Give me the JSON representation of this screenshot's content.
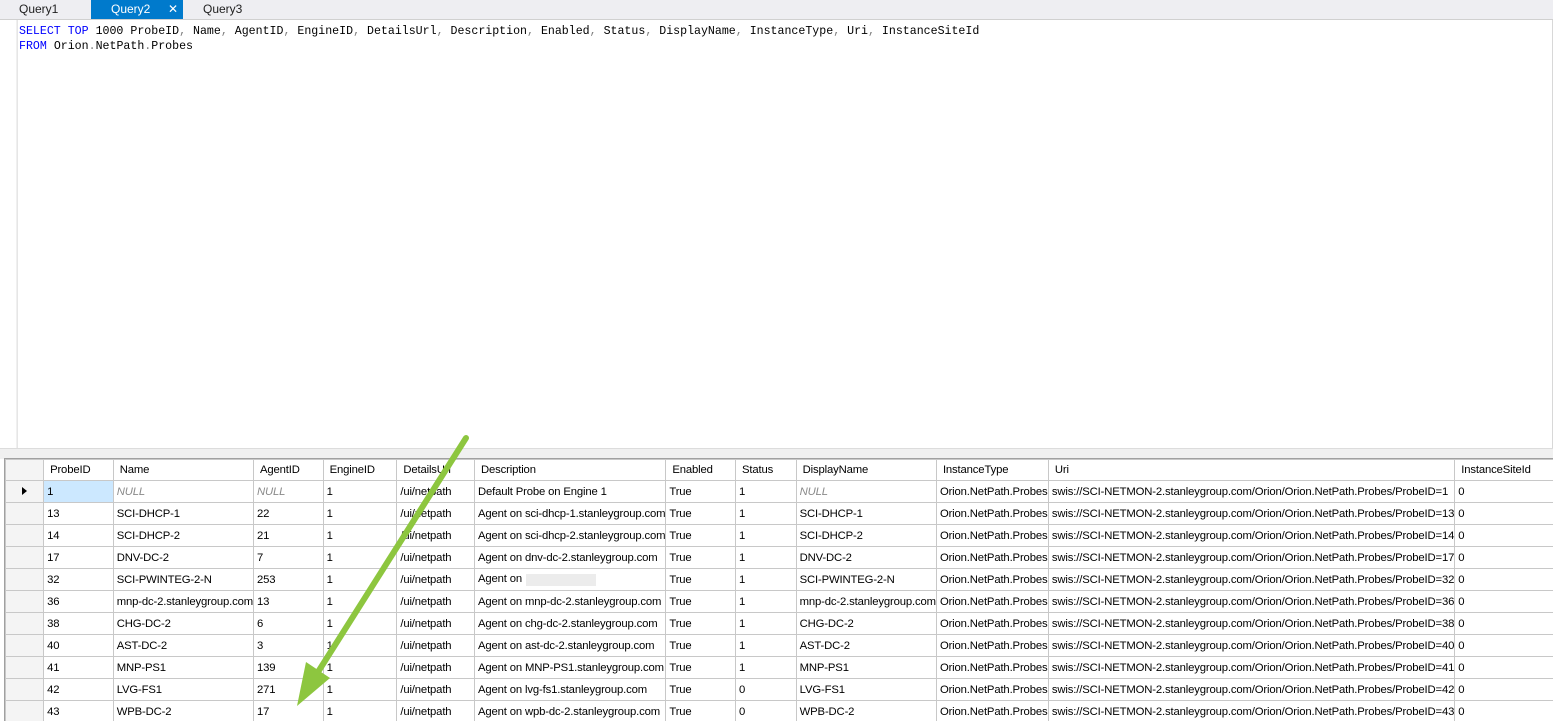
{
  "tabs": [
    {
      "label": "Query1",
      "active": false
    },
    {
      "label": "Query2",
      "active": true,
      "close": "✕"
    },
    {
      "label": "Query3",
      "active": false
    }
  ],
  "editor": {
    "line1": {
      "kw_select": "SELECT",
      "kw_top": "TOP",
      "limit": "1000",
      "columns": [
        {
          "name": "ProbeID",
          "sep": ", "
        },
        {
          "name": "Name",
          "sep": ", "
        },
        {
          "name": "AgentID",
          "sep": ", "
        },
        {
          "name": "EngineID",
          "sep": ", "
        },
        {
          "name": "DetailsUrl",
          "sep": ", "
        },
        {
          "name": "Description",
          "sep": ", "
        },
        {
          "name": "Enabled",
          "sep": ", "
        },
        {
          "name": "Status",
          "sep": ", "
        },
        {
          "name": "DisplayName",
          "sep": ", "
        },
        {
          "name": "InstanceType",
          "sep": ", "
        },
        {
          "name": "Uri",
          "sep": ", "
        },
        {
          "name": "InstanceSiteId",
          "sep": ""
        }
      ]
    },
    "line2": {
      "kw_from": "FROM",
      "tbl1": "Orion",
      "dot1": ".",
      "tbl2": "NetPath",
      "dot2": ".",
      "tbl3": "Probes"
    }
  },
  "grid": {
    "columns": [
      "ProbeID",
      "Name",
      "AgentID",
      "EngineID",
      "DetailsUrl",
      "Description",
      "Enabled",
      "Status",
      "DisplayName",
      "InstanceType",
      "Uri",
      "InstanceSiteId"
    ],
    "rows": [
      [
        "1",
        "NULL",
        "NULL",
        "1",
        "/ui/netpath",
        "Default Probe on Engine 1",
        "True",
        "1",
        "NULL",
        "Orion.NetPath.Probes",
        "swis://SCI-NETMON-2.stanleygroup.com/Orion/Orion.NetPath.Probes/ProbeID=1",
        "0"
      ],
      [
        "13",
        "SCI-DHCP-1",
        "22",
        "1",
        "/ui/netpath",
        "Agent on sci-dhcp-1.stanleygroup.com",
        "True",
        "1",
        "SCI-DHCP-1",
        "Orion.NetPath.Probes",
        "swis://SCI-NETMON-2.stanleygroup.com/Orion/Orion.NetPath.Probes/ProbeID=13",
        "0"
      ],
      [
        "14",
        "SCI-DHCP-2",
        "21",
        "1",
        "/ui/netpath",
        "Agent on sci-dhcp-2.stanleygroup.com",
        "True",
        "1",
        "SCI-DHCP-2",
        "Orion.NetPath.Probes",
        "swis://SCI-NETMON-2.stanleygroup.com/Orion/Orion.NetPath.Probes/ProbeID=14",
        "0"
      ],
      [
        "17",
        "DNV-DC-2",
        "7",
        "1",
        "/ui/netpath",
        "Agent on dnv-dc-2.stanleygroup.com",
        "True",
        "1",
        "DNV-DC-2",
        "Orion.NetPath.Probes",
        "swis://SCI-NETMON-2.stanleygroup.com/Orion/Orion.NetPath.Probes/ProbeID=17",
        "0"
      ],
      [
        "32",
        "SCI-PWINTEG-2-N",
        "253",
        "1",
        "/ui/netpath",
        "Agent on",
        "True",
        "1",
        "SCI-PWINTEG-2-N",
        "Orion.NetPath.Probes",
        "swis://SCI-NETMON-2.stanleygroup.com/Orion/Orion.NetPath.Probes/ProbeID=32",
        "0"
      ],
      [
        "36",
        "mnp-dc-2.stanleygroup.com",
        "13",
        "1",
        "/ui/netpath",
        "Agent on mnp-dc-2.stanleygroup.com",
        "True",
        "1",
        "mnp-dc-2.stanleygroup.com",
        "Orion.NetPath.Probes",
        "swis://SCI-NETMON-2.stanleygroup.com/Orion/Orion.NetPath.Probes/ProbeID=36",
        "0"
      ],
      [
        "38",
        "CHG-DC-2",
        "6",
        "1",
        "/ui/netpath",
        "Agent on chg-dc-2.stanleygroup.com",
        "True",
        "1",
        "CHG-DC-2",
        "Orion.NetPath.Probes",
        "swis://SCI-NETMON-2.stanleygroup.com/Orion/Orion.NetPath.Probes/ProbeID=38",
        "0"
      ],
      [
        "40",
        "AST-DC-2",
        "3",
        "1",
        "/ui/netpath",
        "Agent on ast-dc-2.stanleygroup.com",
        "True",
        "1",
        "AST-DC-2",
        "Orion.NetPath.Probes",
        "swis://SCI-NETMON-2.stanleygroup.com/Orion/Orion.NetPath.Probes/ProbeID=40",
        "0"
      ],
      [
        "41",
        "MNP-PS1",
        "139",
        "1",
        "/ui/netpath",
        "Agent on MNP-PS1.stanleygroup.com",
        "True",
        "1",
        "MNP-PS1",
        "Orion.NetPath.Probes",
        "swis://SCI-NETMON-2.stanleygroup.com/Orion/Orion.NetPath.Probes/ProbeID=41",
        "0"
      ],
      [
        "42",
        "LVG-FS1",
        "271",
        "1",
        "/ui/netpath",
        "Agent on lvg-fs1.stanleygroup.com",
        "True",
        "0",
        "LVG-FS1",
        "Orion.NetPath.Probes",
        "swis://SCI-NETMON-2.stanleygroup.com/Orion/Orion.NetPath.Probes/ProbeID=42",
        "0"
      ],
      [
        "43",
        "WPB-DC-2",
        "17",
        "1",
        "/ui/netpath",
        "Agent on wpb-dc-2.stanleygroup.com",
        "True",
        "0",
        "WPB-DC-2",
        "Orion.NetPath.Probes",
        "swis://SCI-NETMON-2.stanleygroup.com/Orion/Orion.NetPath.Probes/ProbeID=43",
        "0"
      ]
    ]
  },
  "colors": {
    "tab_active": "#007acc",
    "keyword": "#0000ff",
    "null_text": "#8a8a8a",
    "annotation_arrow": "#8dc63f",
    "selected_cell": "#cce8ff"
  }
}
